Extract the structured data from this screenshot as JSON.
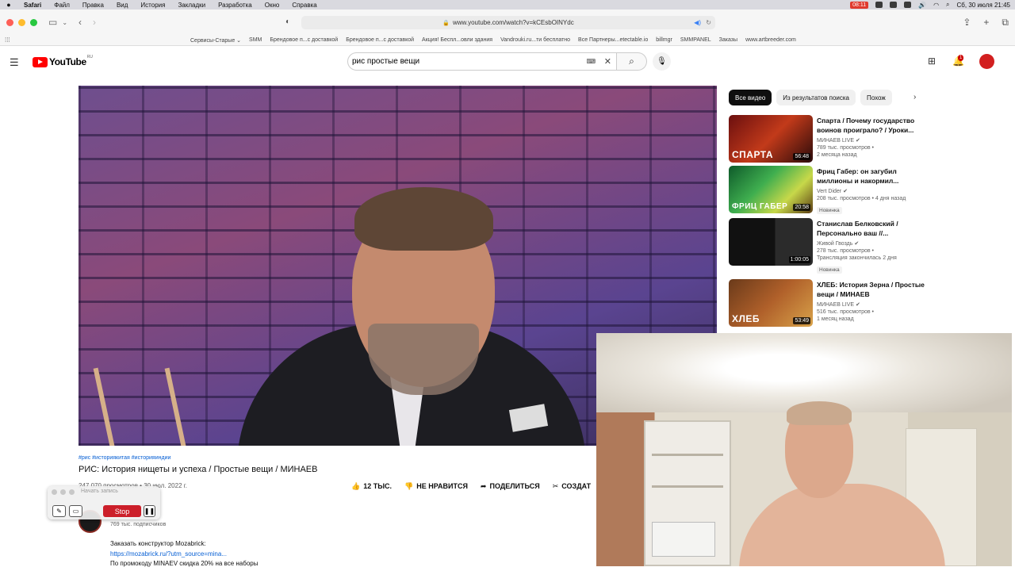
{
  "menubar": {
    "apple": "",
    "items": [
      "Safari",
      "Файл",
      "Правка",
      "Вид",
      "История",
      "Закладки",
      "Разработка",
      "Окно",
      "Справка"
    ],
    "recording": "08:11",
    "datetime": "Сб, 30 июля 21:45"
  },
  "browser": {
    "url": "www.youtube.com/watch?v=kCEsbOINYdc",
    "bookmarks": [
      "Сервисы-Старые ⌄",
      "SMM",
      "Брендовое п...с доставкой",
      "Брендовое п...с доставкой",
      "Акция! Беспл...овли здания",
      "Vandrouki.ru...ти бесплатно",
      "Все Партнеры...etectable.io",
      "billmgr",
      "SMMPANEL",
      "Заказы",
      "www.artbreeder.com"
    ]
  },
  "header": {
    "logo": "YouTube",
    "region": "RU",
    "search_value": "рис простые вещи",
    "notif_count": "1"
  },
  "video": {
    "hashtags": "#рис #историякитая #историяиндии",
    "title": "РИС: История нищеты и успеха / Простые вещи / МИНАЕВ",
    "views_date": "247 070 просмотров • 30 июл. 2022 г.",
    "like_label": "12 ТЫС.",
    "dislike_label": "НЕ НРАВИТСЯ",
    "share_label": "ПОДЕЛИТЬСЯ",
    "create_label": "СОЗДАТ",
    "subscribers": "769 тыс. подписчиков",
    "desc_line1": "Заказать конструктор Mozabrick:",
    "desc_line2": "https://mozabrick.ru/?utm_source=mina...",
    "desc_line3": "По промокоду MINAEV скидка 20% на все наборы"
  },
  "recorder": {
    "title": "Начать запись",
    "stop_label": "Stop"
  },
  "sidebar": {
    "chips": [
      "Все видео",
      "Из результатов поиска",
      "Похож"
    ],
    "items": [
      {
        "title": "Спарта / Почему государство воинов проиграло? / Уроки...",
        "channel": "МИНАЕВ LIVE",
        "views": "789 тыс. просмотров •",
        "age": "2 месяца назад",
        "duration": "56:48",
        "thumb_text": "СПАРТА",
        "badge": ""
      },
      {
        "title": "Фриц Габер: он загубил миллионы и накормил...",
        "channel": "Vert Dider",
        "views": "208 тыс. просмотров • 4 дня назад",
        "age": "",
        "duration": "20:58",
        "thumb_text": "ФРИЦ ГАБЕР",
        "badge": "Новинка"
      },
      {
        "title": "Станислав Белковский / Персонально ваш //...",
        "channel": "Живой Гвоздь",
        "views": "278 тыс. просмотров •",
        "age": "Трансляция закончилась 2 дня",
        "duration": "1:00:05",
        "thumb_text": "",
        "badge": "Новинка"
      },
      {
        "title": "ХЛЕБ: История Зерна / Простые вещи / МИНАЕВ",
        "channel": "МИНАЕВ LIVE",
        "views": "516 тыс. просмотров •",
        "age": "1 месяц назад",
        "duration": "53:49",
        "thumb_text": "ХЛЕБ",
        "badge": ""
      }
    ]
  },
  "colors": {
    "yt_red": "#ff0000",
    "link_blue": "#065fd4",
    "stop_red": "#cc1f2a"
  }
}
